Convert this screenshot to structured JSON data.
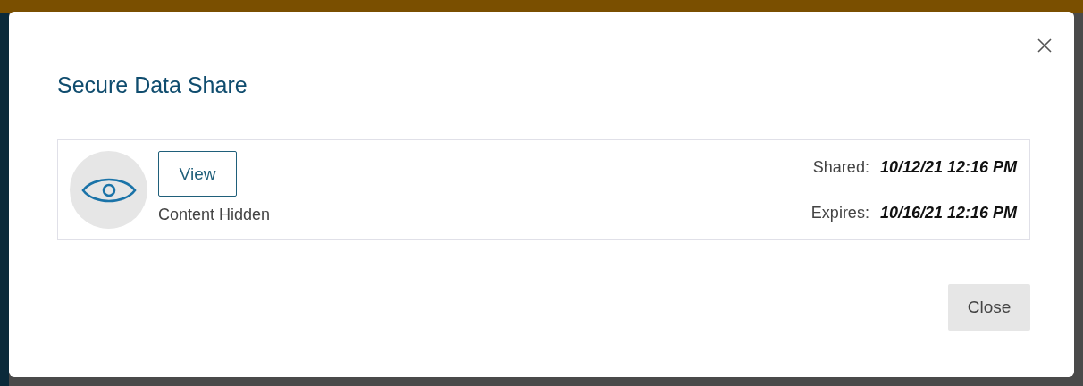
{
  "dialog": {
    "title": "Secure Data Share",
    "share": {
      "content_hidden": true,
      "view_button": "View",
      "status": "Content Hidden",
      "details": [
        {
          "label": "Shared:",
          "value": "10/12/21 12:16 PM"
        },
        {
          "label": "Expires:",
          "value": "10/16/21 12:16 PM"
        }
      ]
    },
    "buttons": [
      "Close"
    ]
  }
}
